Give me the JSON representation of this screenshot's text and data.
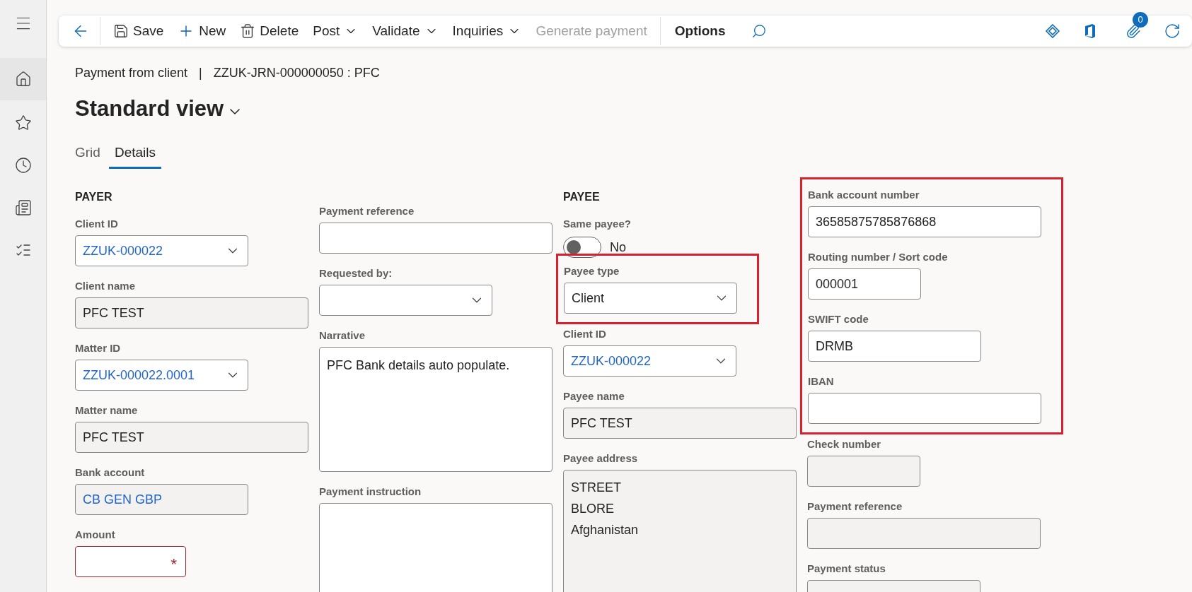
{
  "toolbar": {
    "actions": [
      {
        "kind": "save",
        "label": "Save",
        "disabled": false
      },
      {
        "kind": "new",
        "label": "New",
        "disabled": false
      },
      {
        "kind": "delete",
        "label": "Delete",
        "disabled": false
      },
      {
        "kind": "menu",
        "label": "Post",
        "disabled": false
      },
      {
        "kind": "menu",
        "label": "Validate",
        "disabled": false
      },
      {
        "kind": "menu",
        "label": "Inquiries",
        "disabled": false
      },
      {
        "kind": "plain",
        "label": "Generate payment",
        "disabled": true
      }
    ],
    "options": "Options",
    "attachments_count": "0"
  },
  "breadcrumb": {
    "form": "Payment from client",
    "separator": "|",
    "record": "ZZUK-JRN-000000050 : PFC"
  },
  "view_title": "Standard view",
  "tabs": [
    {
      "label": "Grid",
      "selected": false
    },
    {
      "label": "Details",
      "selected": true
    }
  ],
  "columns": [
    {
      "heading": "PAYER",
      "fields": [
        {
          "kind": "lookup",
          "label": "Client ID",
          "value": "ZZUK-000022",
          "link": true,
          "highlighted": false
        },
        {
          "kind": "readonly",
          "label": "Client name",
          "value": "PFC TEST",
          "link": false,
          "highlighted": false
        },
        {
          "kind": "lookup",
          "label": "Matter ID",
          "value": "ZZUK-000022.0001",
          "link": true,
          "highlighted": false
        },
        {
          "kind": "readonly",
          "label": "Matter name",
          "value": "PFC TEST",
          "link": false,
          "highlighted": false
        },
        {
          "kind": "readonly",
          "label": "Bank account",
          "value": "CB GEN GBP",
          "link": true,
          "highlighted": false
        },
        {
          "kind": "required",
          "label": "Amount",
          "mark": "*",
          "highlighted": false
        }
      ]
    },
    {
      "fields": [
        {
          "kind": "text",
          "label": "Payment reference",
          "highlighted": false
        },
        {
          "kind": "lookup",
          "label": "Requested by:",
          "highlighted": false
        },
        {
          "kind": "textarea",
          "label": "Narrative",
          "value": "PFC Bank details auto populate.",
          "highlighted": false
        },
        {
          "kind": "textarea",
          "label": "Payment instruction",
          "highlighted": false
        }
      ]
    },
    {
      "heading": "PAYEE",
      "fields": [
        {
          "kind": "toggle",
          "label": "Same payee?",
          "on": false,
          "state_text": "No",
          "highlighted": false
        },
        {
          "kind": "lookup",
          "label": "Payee type",
          "value": "Client",
          "link": false,
          "highlighted": true
        },
        {
          "kind": "lookup",
          "label": "Client ID",
          "value": "ZZUK-000022",
          "link": true,
          "highlighted": false
        },
        {
          "kind": "readonly",
          "label": "Payee name",
          "value": "PFC TEST",
          "link": false,
          "highlighted": false
        },
        {
          "kind": "address",
          "label": "Payee address",
          "lines": [
            "STREET",
            "BLORE",
            "Afghanistan"
          ],
          "highlighted": false
        }
      ]
    },
    {
      "fields": [
        {
          "kind": "text",
          "label": "Bank account number",
          "value": "36585875785876868",
          "highlighted": true
        },
        {
          "kind": "text",
          "label": "Routing number / Sort code",
          "value": "000001",
          "highlighted": true
        },
        {
          "kind": "text",
          "label": "SWIFT code",
          "value": "DRMB",
          "highlighted": true
        },
        {
          "kind": "text",
          "label": "IBAN",
          "highlighted": true
        },
        {
          "kind": "readonly",
          "label": "Check number",
          "highlighted": false
        },
        {
          "kind": "readonly",
          "label": "Payment reference",
          "highlighted": false
        },
        {
          "kind": "readonly",
          "label": "Payment status",
          "highlighted": false
        }
      ]
    }
  ]
}
